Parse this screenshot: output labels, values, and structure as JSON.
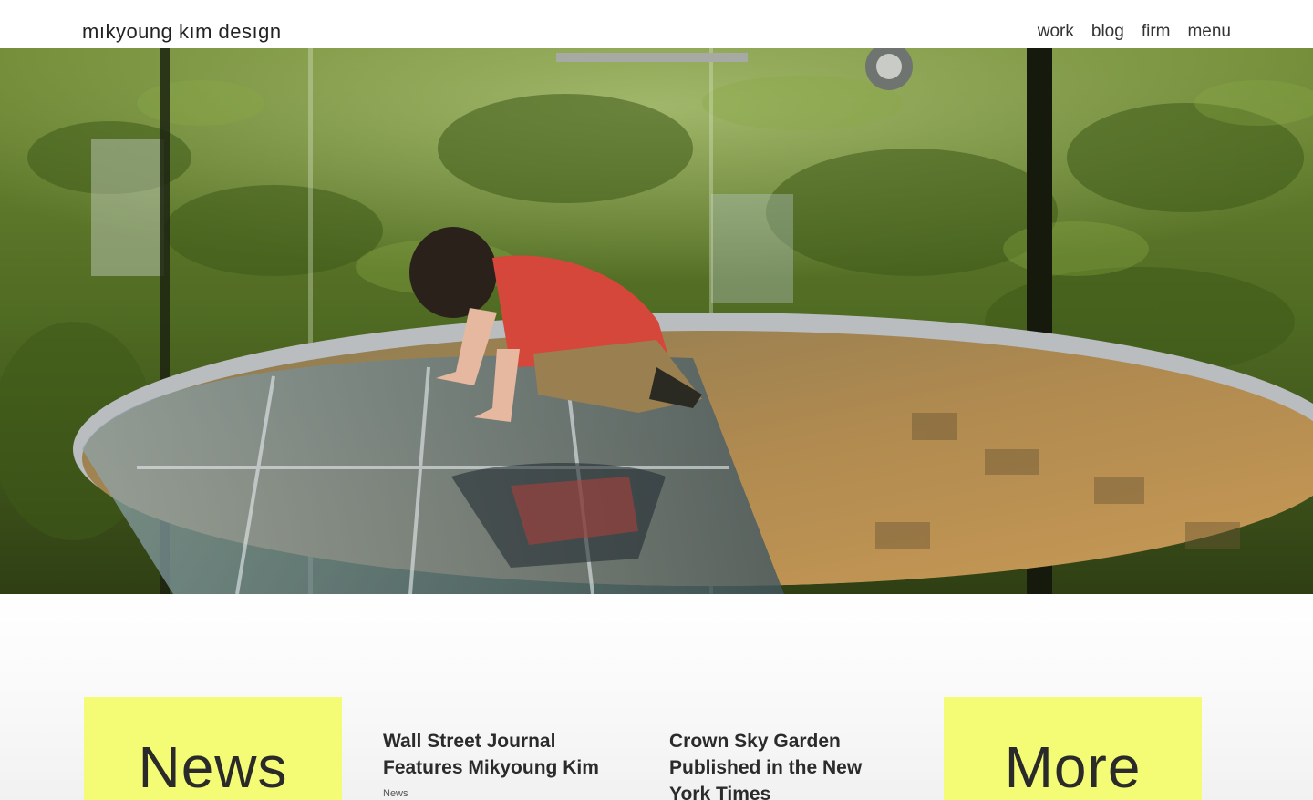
{
  "header": {
    "logo": "mıkyoung kım desıgn",
    "nav": [
      {
        "label": "work"
      },
      {
        "label": "blog"
      },
      {
        "label": "firm"
      },
      {
        "label": "menu"
      }
    ]
  },
  "hero": {
    "image_alt": "Child kneeling on glass floor in bamboo garden"
  },
  "tiles": {
    "news": "News",
    "more": "More"
  },
  "articles": [
    {
      "title": "Wall Street Journal Features Mikyoung Kim",
      "category": "News"
    },
    {
      "title": "Crown Sky Garden Published in the New York Times",
      "category": ""
    }
  ],
  "colors": {
    "tile_bg": "#f4fb74",
    "text": "#2b2b2b"
  }
}
